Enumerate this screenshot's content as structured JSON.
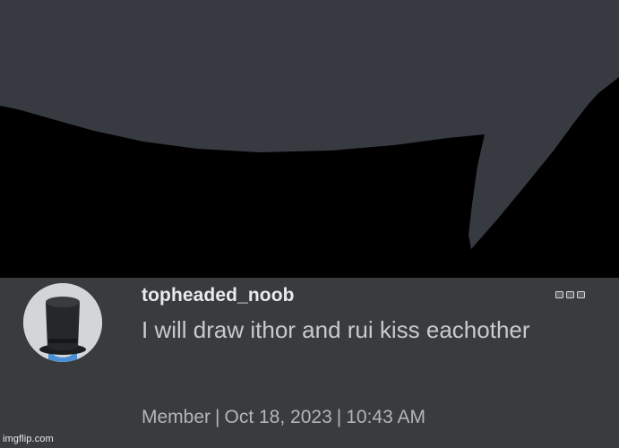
{
  "drawing": {
    "bubble_color": "#383a42",
    "background_color": "#000000"
  },
  "comment": {
    "avatar_icon": "top-hat-avatar",
    "username": "topheaded_noob",
    "text": "I will draw ithor and rui kiss eachother",
    "role": "Member",
    "date": "Oct 18, 2023",
    "time": "10:43 AM",
    "separator": "|",
    "menu_icon": "more-options-icon",
    "panel_color": "#393b3d"
  },
  "watermark": "imgflip.com"
}
